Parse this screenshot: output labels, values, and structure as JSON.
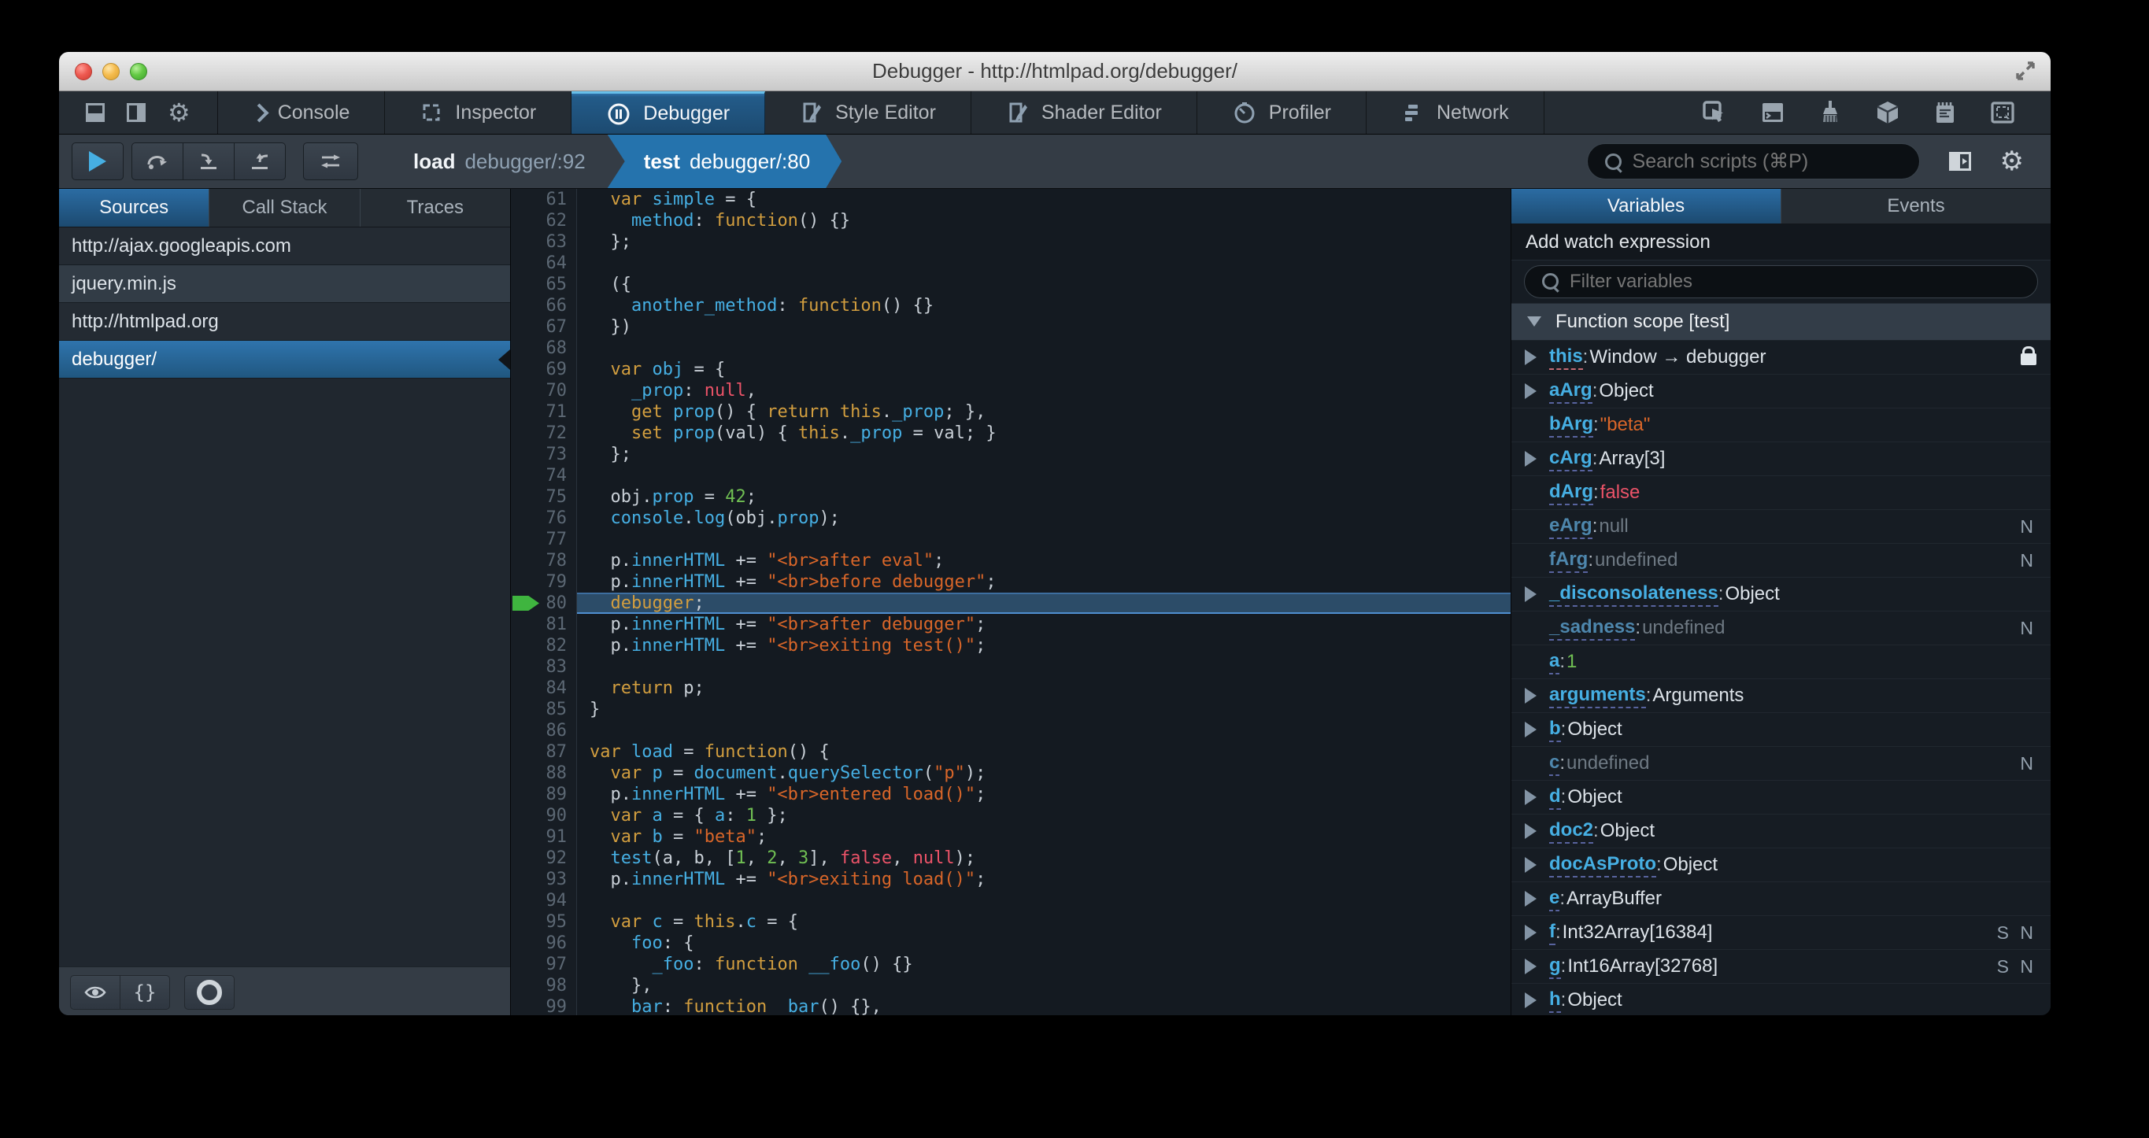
{
  "window": {
    "title": "Debugger - http://htmlpad.org/debugger/"
  },
  "colors": {
    "accent_blue": "#46afe3",
    "active_tab_blue": "#1c4a70",
    "toolbar_gray": "#343c45",
    "editor_bg": "#141a21",
    "keyword": "#d29e3f",
    "string": "#d96629",
    "number": "#70bf53",
    "atom_red": "#eb5368",
    "debug_line": "#2c4c68",
    "debug_arrow_green": "#3fb53f"
  },
  "toolbox": {
    "tabs": [
      {
        "label": "Console"
      },
      {
        "label": "Inspector"
      },
      {
        "label": "Debugger",
        "active": true
      },
      {
        "label": "Style Editor"
      },
      {
        "label": "Shader Editor"
      },
      {
        "label": "Profiler"
      },
      {
        "label": "Network"
      }
    ]
  },
  "debugger_toolbar": {
    "breadcrumbs": [
      {
        "fn": "load",
        "loc": "debugger/:92"
      },
      {
        "fn": "test",
        "loc": "debugger/:80",
        "active": true
      }
    ],
    "search_placeholder": "Search scripts (⌘P)"
  },
  "sources": {
    "tabs": [
      "Sources",
      "Call Stack",
      "Traces"
    ],
    "items": [
      {
        "label": "http://ajax.googleapis.com",
        "type": "group"
      },
      {
        "label": "jquery.min.js",
        "type": "file"
      },
      {
        "label": "http://htmlpad.org",
        "type": "group"
      },
      {
        "label": "debugger/",
        "type": "file",
        "selected": true
      }
    ]
  },
  "editor": {
    "lines": [
      {
        "n": 61,
        "s": [
          [
            "d",
            "  "
          ],
          [
            "k",
            "var"
          ],
          [
            "d",
            " "
          ],
          [
            "v",
            "simple"
          ],
          [
            "d",
            " = {"
          ]
        ]
      },
      {
        "n": 62,
        "s": [
          [
            "d",
            "    "
          ],
          [
            "v",
            "method"
          ],
          [
            "d",
            ": "
          ],
          [
            "k",
            "function"
          ],
          [
            "d",
            "() {}"
          ]
        ]
      },
      {
        "n": 63,
        "s": [
          [
            "d",
            "  };"
          ]
        ]
      },
      {
        "n": 64,
        "s": []
      },
      {
        "n": 65,
        "s": [
          [
            "d",
            "  ({"
          ]
        ]
      },
      {
        "n": 66,
        "s": [
          [
            "d",
            "    "
          ],
          [
            "v",
            "another_method"
          ],
          [
            "d",
            ": "
          ],
          [
            "k",
            "function"
          ],
          [
            "d",
            "() {}"
          ]
        ]
      },
      {
        "n": 67,
        "s": [
          [
            "d",
            "  })"
          ]
        ]
      },
      {
        "n": 68,
        "s": []
      },
      {
        "n": 69,
        "s": [
          [
            "d",
            "  "
          ],
          [
            "k",
            "var"
          ],
          [
            "d",
            " "
          ],
          [
            "v",
            "obj"
          ],
          [
            "d",
            " = {"
          ]
        ]
      },
      {
        "n": 70,
        "s": [
          [
            "d",
            "    "
          ],
          [
            "v",
            "_prop"
          ],
          [
            "d",
            ": "
          ],
          [
            "a",
            "null"
          ],
          [
            "d",
            ","
          ]
        ]
      },
      {
        "n": 71,
        "s": [
          [
            "d",
            "    "
          ],
          [
            "k",
            "get"
          ],
          [
            "d",
            " "
          ],
          [
            "v",
            "prop"
          ],
          [
            "d",
            "() { "
          ],
          [
            "k",
            "return"
          ],
          [
            "d",
            " "
          ],
          [
            "k",
            "this"
          ],
          [
            "d",
            "."
          ],
          [
            "v",
            "_prop"
          ],
          [
            "d",
            "; },"
          ]
        ]
      },
      {
        "n": 72,
        "s": [
          [
            "d",
            "    "
          ],
          [
            "k",
            "set"
          ],
          [
            "d",
            " "
          ],
          [
            "v",
            "prop"
          ],
          [
            "d",
            "(val) { "
          ],
          [
            "k",
            "this"
          ],
          [
            "d",
            "."
          ],
          [
            "v",
            "_prop"
          ],
          [
            "d",
            " = val; }"
          ]
        ]
      },
      {
        "n": 73,
        "s": [
          [
            "d",
            "  };"
          ]
        ]
      },
      {
        "n": 74,
        "s": []
      },
      {
        "n": 75,
        "s": [
          [
            "d",
            "  obj."
          ],
          [
            "v",
            "prop"
          ],
          [
            "d",
            " = "
          ],
          [
            "n",
            "42"
          ],
          [
            "d",
            ";"
          ]
        ]
      },
      {
        "n": 76,
        "s": [
          [
            "d",
            "  "
          ],
          [
            "v",
            "console"
          ],
          [
            "d",
            "."
          ],
          [
            "v",
            "log"
          ],
          [
            "d",
            "(obj."
          ],
          [
            "v",
            "prop"
          ],
          [
            "d",
            ");"
          ]
        ]
      },
      {
        "n": 77,
        "s": []
      },
      {
        "n": 78,
        "s": [
          [
            "d",
            "  p."
          ],
          [
            "v",
            "innerHTML"
          ],
          [
            "d",
            " += "
          ],
          [
            "s",
            "\"<br>after eval\""
          ],
          [
            "d",
            ";"
          ]
        ]
      },
      {
        "n": 79,
        "s": [
          [
            "d",
            "  p."
          ],
          [
            "v",
            "innerHTML"
          ],
          [
            "d",
            " += "
          ],
          [
            "s",
            "\"<br>before debugger\""
          ],
          [
            "d",
            ";"
          ]
        ]
      },
      {
        "n": 80,
        "cur": true,
        "s": [
          [
            "d",
            "  "
          ],
          [
            "k",
            "debugger"
          ],
          [
            "d",
            ";"
          ]
        ]
      },
      {
        "n": 81,
        "s": [
          [
            "d",
            "  p."
          ],
          [
            "v",
            "innerHTML"
          ],
          [
            "d",
            " += "
          ],
          [
            "s",
            "\"<br>after debugger\""
          ],
          [
            "d",
            ";"
          ]
        ]
      },
      {
        "n": 82,
        "s": [
          [
            "d",
            "  p."
          ],
          [
            "v",
            "innerHTML"
          ],
          [
            "d",
            " += "
          ],
          [
            "s",
            "\"<br>exiting test()\""
          ],
          [
            "d",
            ";"
          ]
        ]
      },
      {
        "n": 83,
        "s": []
      },
      {
        "n": 84,
        "s": [
          [
            "d",
            "  "
          ],
          [
            "k",
            "return"
          ],
          [
            "d",
            " p;"
          ]
        ]
      },
      {
        "n": 85,
        "s": [
          [
            "d",
            "}"
          ]
        ]
      },
      {
        "n": 86,
        "s": []
      },
      {
        "n": 87,
        "s": [
          [
            "k",
            "var"
          ],
          [
            "d",
            " "
          ],
          [
            "v",
            "load"
          ],
          [
            "d",
            " = "
          ],
          [
            "k",
            "function"
          ],
          [
            "d",
            "() {"
          ]
        ]
      },
      {
        "n": 88,
        "s": [
          [
            "d",
            "  "
          ],
          [
            "k",
            "var"
          ],
          [
            "d",
            " "
          ],
          [
            "v",
            "p"
          ],
          [
            "d",
            " = "
          ],
          [
            "v",
            "document"
          ],
          [
            "d",
            "."
          ],
          [
            "v",
            "querySelector"
          ],
          [
            "d",
            "("
          ],
          [
            "s",
            "\"p\""
          ],
          [
            "d",
            ");"
          ]
        ]
      },
      {
        "n": 89,
        "s": [
          [
            "d",
            "  p."
          ],
          [
            "v",
            "innerHTML"
          ],
          [
            "d",
            " += "
          ],
          [
            "s",
            "\"<br>entered load()\""
          ],
          [
            "d",
            ";"
          ]
        ]
      },
      {
        "n": 90,
        "s": [
          [
            "d",
            "  "
          ],
          [
            "k",
            "var"
          ],
          [
            "d",
            " "
          ],
          [
            "v",
            "a"
          ],
          [
            "d",
            " = { "
          ],
          [
            "v",
            "a"
          ],
          [
            "d",
            ": "
          ],
          [
            "n",
            "1"
          ],
          [
            "d",
            " };"
          ]
        ]
      },
      {
        "n": 91,
        "s": [
          [
            "d",
            "  "
          ],
          [
            "k",
            "var"
          ],
          [
            "d",
            " "
          ],
          [
            "v",
            "b"
          ],
          [
            "d",
            " = "
          ],
          [
            "s",
            "\"beta\""
          ],
          [
            "d",
            ";"
          ]
        ]
      },
      {
        "n": 92,
        "s": [
          [
            "d",
            "  "
          ],
          [
            "v",
            "test"
          ],
          [
            "d",
            "(a, b, ["
          ],
          [
            "n",
            "1"
          ],
          [
            "d",
            ", "
          ],
          [
            "n",
            "2"
          ],
          [
            "d",
            ", "
          ],
          [
            "n",
            "3"
          ],
          [
            "d",
            "], "
          ],
          [
            "a",
            "false"
          ],
          [
            "d",
            ", "
          ],
          [
            "a",
            "null"
          ],
          [
            "d",
            ");"
          ]
        ]
      },
      {
        "n": 93,
        "s": [
          [
            "d",
            "  p."
          ],
          [
            "v",
            "innerHTML"
          ],
          [
            "d",
            " += "
          ],
          [
            "s",
            "\"<br>exiting load()\""
          ],
          [
            "d",
            ";"
          ]
        ]
      },
      {
        "n": 94,
        "s": []
      },
      {
        "n": 95,
        "s": [
          [
            "d",
            "  "
          ],
          [
            "k",
            "var"
          ],
          [
            "d",
            " "
          ],
          [
            "v",
            "c"
          ],
          [
            "d",
            " = "
          ],
          [
            "k",
            "this"
          ],
          [
            "d",
            "."
          ],
          [
            "v",
            "c"
          ],
          [
            "d",
            " = {"
          ]
        ]
      },
      {
        "n": 96,
        "s": [
          [
            "d",
            "    "
          ],
          [
            "v",
            "foo"
          ],
          [
            "d",
            ": {"
          ]
        ]
      },
      {
        "n": 97,
        "s": [
          [
            "d",
            "      "
          ],
          [
            "v",
            "_foo"
          ],
          [
            "d",
            ": "
          ],
          [
            "k",
            "function"
          ],
          [
            "d",
            " "
          ],
          [
            "v",
            "__foo"
          ],
          [
            "d",
            "() {}"
          ]
        ]
      },
      {
        "n": 98,
        "s": [
          [
            "d",
            "    },"
          ]
        ]
      },
      {
        "n": 99,
        "s": [
          [
            "d",
            "    "
          ],
          [
            "v",
            "bar"
          ],
          [
            "d",
            ": "
          ],
          [
            "k",
            "function"
          ],
          [
            "d",
            " "
          ],
          [
            "v",
            "_bar"
          ],
          [
            "d",
            "() {},"
          ]
        ]
      }
    ]
  },
  "variables": {
    "tabs": [
      "Variables",
      "Events"
    ],
    "watch_label": "Add watch expression",
    "filter_placeholder": "Filter variables",
    "scope_label": "Function scope [test]",
    "rows": [
      {
        "name": "this",
        "value": "Window → debugger",
        "vc": "obj",
        "exp": true,
        "lock": true,
        "u": "pink"
      },
      {
        "name": "aArg",
        "value": "Object",
        "vc": "obj",
        "exp": true
      },
      {
        "name": "bArg",
        "value": "\"beta\"",
        "vc": "str"
      },
      {
        "name": "cArg",
        "value": "Array[3]",
        "vc": "obj",
        "exp": true
      },
      {
        "name": "dArg",
        "value": "false",
        "vc": "bool"
      },
      {
        "name": "eArg",
        "value": "null",
        "vc": "muted",
        "dim": true,
        "badges": "N"
      },
      {
        "name": "fArg",
        "value": "undefined",
        "vc": "muted",
        "dim": true,
        "badges": "N"
      },
      {
        "name": "_disconsolateness",
        "value": "Object",
        "vc": "obj",
        "exp": true
      },
      {
        "name": "_sadness",
        "value": "undefined",
        "vc": "muted",
        "dim": true,
        "badges": "N"
      },
      {
        "name": "a",
        "value": "1",
        "vc": "num"
      },
      {
        "name": "arguments",
        "value": "Arguments",
        "vc": "obj",
        "exp": true
      },
      {
        "name": "b",
        "value": "Object",
        "vc": "obj",
        "exp": true
      },
      {
        "name": "c",
        "value": "undefined",
        "vc": "muted",
        "dim": true,
        "badges": "N"
      },
      {
        "name": "d",
        "value": "Object",
        "vc": "obj",
        "exp": true
      },
      {
        "name": "doc2",
        "value": "Object",
        "vc": "obj",
        "exp": true
      },
      {
        "name": "docAsProto",
        "value": "Object",
        "vc": "obj",
        "exp": true
      },
      {
        "name": "e",
        "value": "ArrayBuffer",
        "vc": "obj",
        "exp": true
      },
      {
        "name": "f",
        "value": "Int32Array[16384]",
        "vc": "obj",
        "exp": true,
        "badges": "S N"
      },
      {
        "name": "g",
        "value": "Int16Array[32768]",
        "vc": "obj",
        "exp": true,
        "badges": "S N"
      },
      {
        "name": "h",
        "value": "Object",
        "vc": "obj",
        "exp": true
      }
    ]
  }
}
